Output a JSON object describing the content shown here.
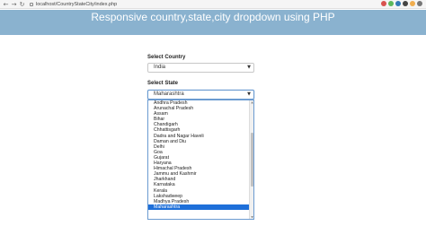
{
  "browser": {
    "url": "localhost/CountryStateCity/index.php",
    "back_icon": "arrow-left-icon",
    "forward_icon": "arrow-right-icon",
    "reload_icon": "reload-icon"
  },
  "banner": {
    "title": "Responsive country,state,city dropdown using PHP",
    "color": "#8ab2cf"
  },
  "country": {
    "label": "Select Country",
    "value": "India"
  },
  "state": {
    "label": "Select State",
    "value": "Maharashtra",
    "options": [
      "Andhra Pradesh",
      "Arunachal Pradesh",
      "Assam",
      "Bihar",
      "Chandigarh",
      "Chhattisgarh",
      "Dadra and Nagar Haveli",
      "Daman and Diu",
      "Delhi",
      "Goa",
      "Gujarat",
      "Haryana",
      "Himachal Pradesh",
      "Jammu and Kashmir",
      "Jharkhand",
      "Karnataka",
      "Kerala",
      "Lakshadweep",
      "Madhya Pradesh",
      "Maharashtra"
    ],
    "selected_index": 19
  }
}
